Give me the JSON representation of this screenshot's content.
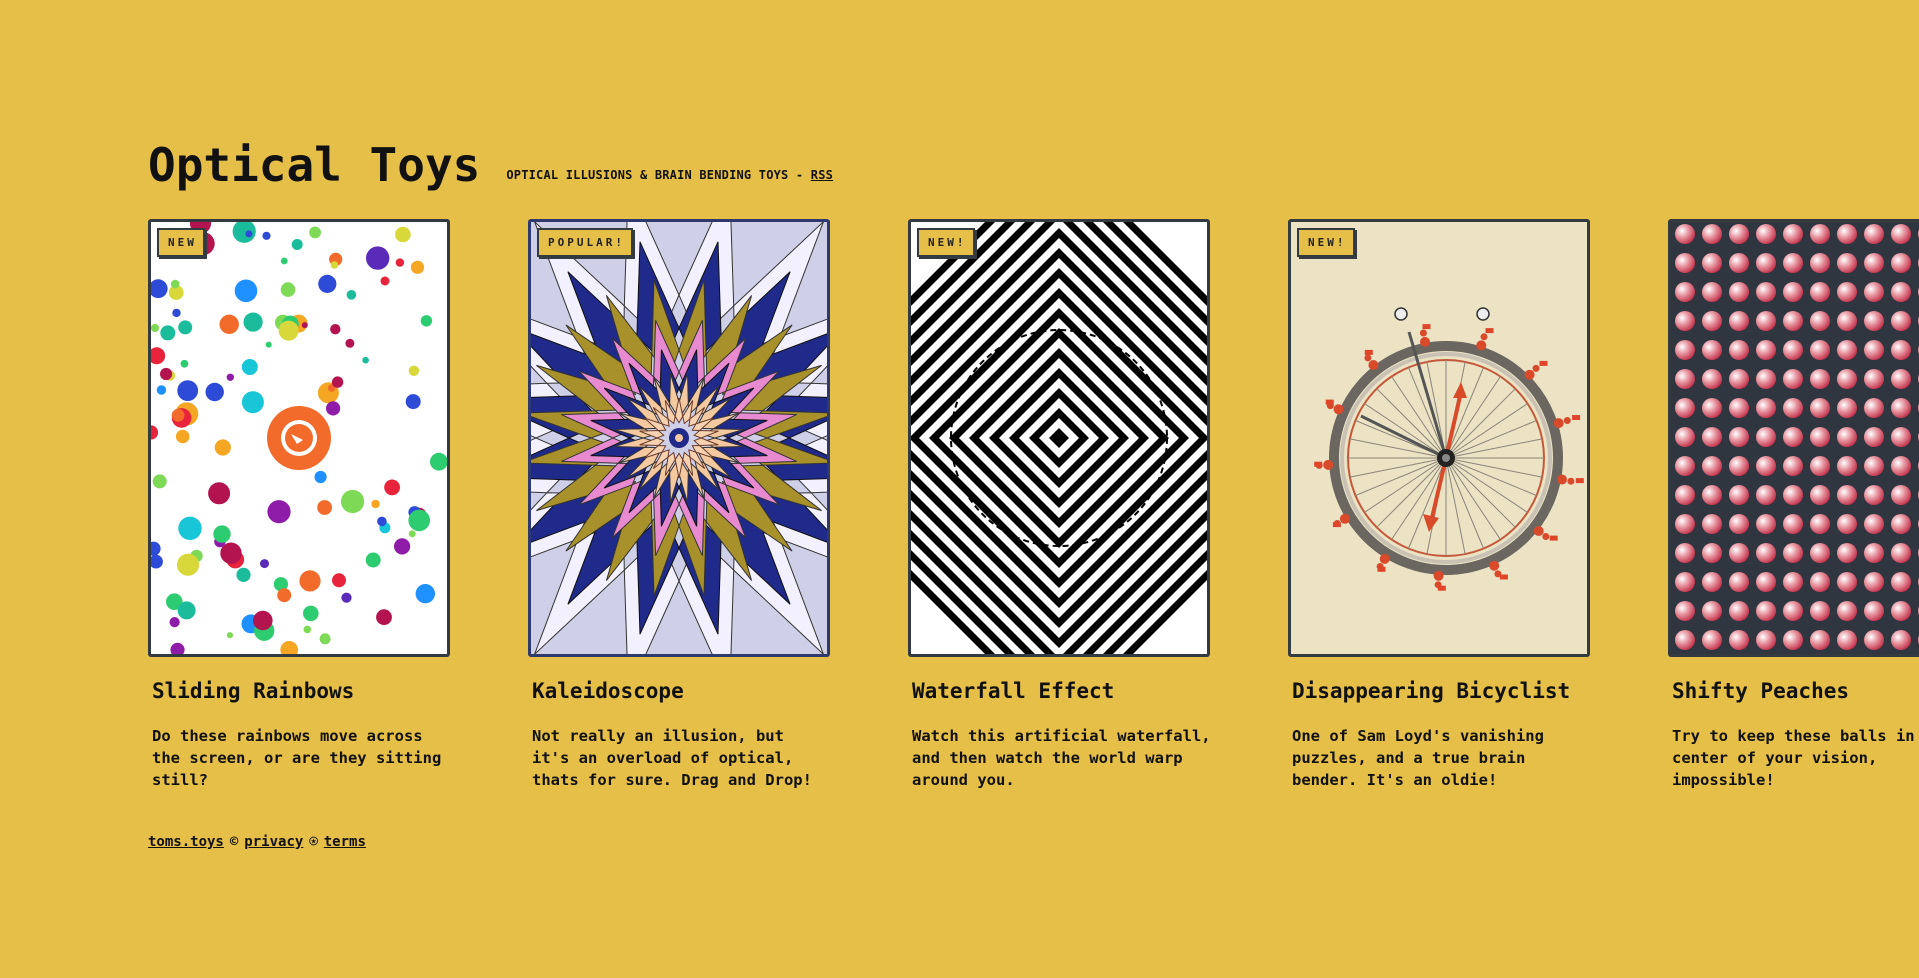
{
  "site": {
    "title": "Optical Toys",
    "subtitle": "OPTICAL ILLUSIONS & BRAIN BENDING TOYS - ",
    "rss_label": "RSS"
  },
  "colors": {
    "background": "#e6bf48",
    "card_border": "#333a40",
    "text": "#111111"
  },
  "cards": [
    {
      "badge": "NEW",
      "title": "Sliding Rainbows",
      "description": "Do these rainbows move across\nthe screen, or are they sitting\nstill?",
      "icon": "sliding-rainbows-thumbnail"
    },
    {
      "badge": "POPULAR!",
      "title": "Kaleidoscope",
      "description": "Not really an illusion, but\nit's an overload of optical,\nthats for sure. Drag and Drop!",
      "icon": "kaleidoscope-thumbnail"
    },
    {
      "badge": "NEW!",
      "title": "Waterfall Effect",
      "description": "Watch this artificial waterfall,\nand then watch the world warp\naround you.",
      "icon": "waterfall-thumbnail"
    },
    {
      "badge": "NEW!",
      "title": "Disappearing Bicyclist",
      "description": "One of Sam Loyd's vanishing\npuzzles, and a true brain\nbender. It's an oldie!",
      "icon": "bicyclist-thumbnail"
    },
    {
      "badge": "",
      "title": "Shifty Peaches",
      "description": "Try to keep these balls in the\ncenter of your vision,\nimpossible!",
      "icon": "peaches-thumbnail"
    }
  ],
  "footer": {
    "site_link": "toms.toys",
    "copyright_symbol": "©",
    "privacy_link": "privacy",
    "separator_symbol": "⍟",
    "terms_link": "terms"
  }
}
